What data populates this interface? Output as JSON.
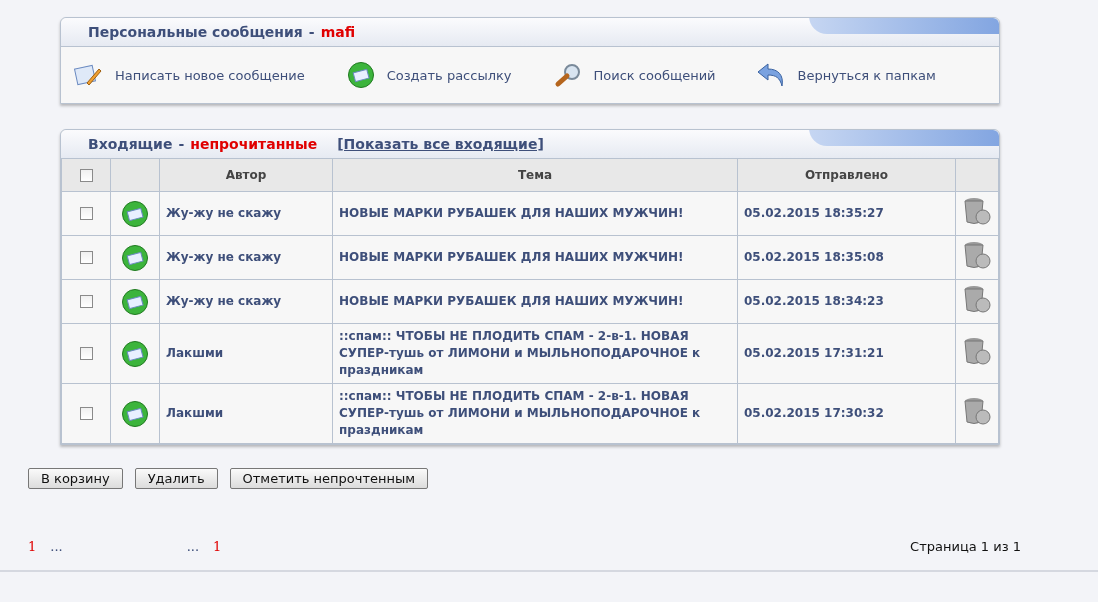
{
  "header": {
    "title": "Персональные сообщения",
    "separator": "-",
    "user": "mafi"
  },
  "actions": [
    {
      "kind": "compose",
      "label": "Написать новое сообщение"
    },
    {
      "kind": "broadcast",
      "label": "Создать рассылку"
    },
    {
      "kind": "search",
      "label": "Поиск сообщений"
    },
    {
      "kind": "back",
      "label": "Вернуться к папкам"
    }
  ],
  "inbox": {
    "title": "Входящие",
    "separator": "-",
    "filter": "непрочитанные",
    "link": "[Показать все входящие]"
  },
  "table": {
    "select_all": {
      "checked": false
    },
    "columns": [
      "Автор",
      "Тема",
      "Отправлено"
    ],
    "rows": [
      {
        "checked": false,
        "author": "Жу-жу не скажу",
        "subject": "НОВЫЕ МАРКИ РУБАШЕК ДЛЯ НАШИХ МУЖЧИН!",
        "sent": "05.02.2015 18:35:27"
      },
      {
        "checked": false,
        "author": "Жу-жу не скажу",
        "subject": "НОВЫЕ МАРКИ РУБАШЕК ДЛЯ НАШИХ МУЖЧИН!",
        "sent": "05.02.2015 18:35:08"
      },
      {
        "checked": false,
        "author": "Жу-жу не скажу",
        "subject": "НОВЫЕ МАРКИ РУБАШЕК ДЛЯ НАШИХ МУЖЧИН!",
        "sent": "05.02.2015 18:34:23"
      },
      {
        "checked": false,
        "author": "Лакшми",
        "subject": "::спам:: ЧТОБЫ НЕ ПЛОДИТЬ СПАМ - 2-в-1. НОВАЯ СУПЕР-тушь от ЛИМОНИ и МЫЛЬНОПОДАРОЧНОЕ к праздникам",
        "sent": "05.02.2015 17:31:21"
      },
      {
        "checked": false,
        "author": "Лакшми",
        "subject": "::спам:: ЧТОБЫ НЕ ПЛОДИТЬ СПАМ - 2-в-1. НОВАЯ СУПЕР-тушь от ЛИМОНИ и МЫЛЬНОПОДАРОЧНОЕ к праздникам",
        "sent": "05.02.2015 17:30:32"
      }
    ]
  },
  "buttons": [
    "В корзину",
    "Удалить",
    "Отметить непрочтенным"
  ],
  "pagination": {
    "left": [
      {
        "kind": "page",
        "text": "1"
      },
      {
        "kind": "ellipsis",
        "text": "..."
      }
    ],
    "right": [
      {
        "kind": "ellipsis",
        "text": "..."
      },
      {
        "kind": "page",
        "text": "1"
      }
    ],
    "status": "Страница 1 из 1"
  }
}
